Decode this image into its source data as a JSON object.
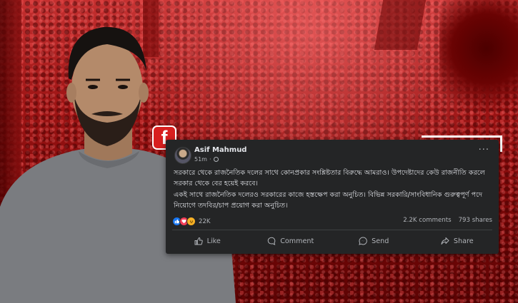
{
  "post": {
    "author": "Asif Mahmud",
    "time": "51m",
    "separator": "·",
    "paragraph_1": "সরকারে থেকে রাজনৈতিক দলের সাথে কোনপ্রকার সংশ্লিষ্টতার বিরুদ্ধে আমরাও। উপদেষ্টাদের কেউ রাজনীতি করলে সরকার থেকে বের হয়েই করবে।",
    "paragraph_2": "একই সাথে রাজনৈতিক দলেরও সরকারের কাজে হস্তক্ষেপ করা অনুচিত। বিভিন্ন সরকারি/সাংবিধানিক গুরুত্বপূর্ণ পদে নিয়োগে তদবির/চাপ প্রয়োগ করা অনুচিত।",
    "more_label": "···"
  },
  "stats": {
    "reactions_count": "22K",
    "comments": "2.2K comments",
    "shares": "793 shares"
  },
  "actions": {
    "like": "Like",
    "comment": "Comment",
    "send": "Send",
    "share": "Share"
  },
  "badge": {
    "label": "f"
  },
  "icons": [
    "facebook-icon",
    "globe-icon",
    "more-icon",
    "like-reaction-icon",
    "love-reaction-icon",
    "haha-reaction-icon",
    "like-icon",
    "comment-icon",
    "send-icon",
    "share-icon"
  ],
  "colors": {
    "card_bg": "#242526",
    "text": "#e4e6eb",
    "muted": "#b0b3b8",
    "fb_blue": "#1877f2",
    "badge_red": "#d81f1f"
  }
}
